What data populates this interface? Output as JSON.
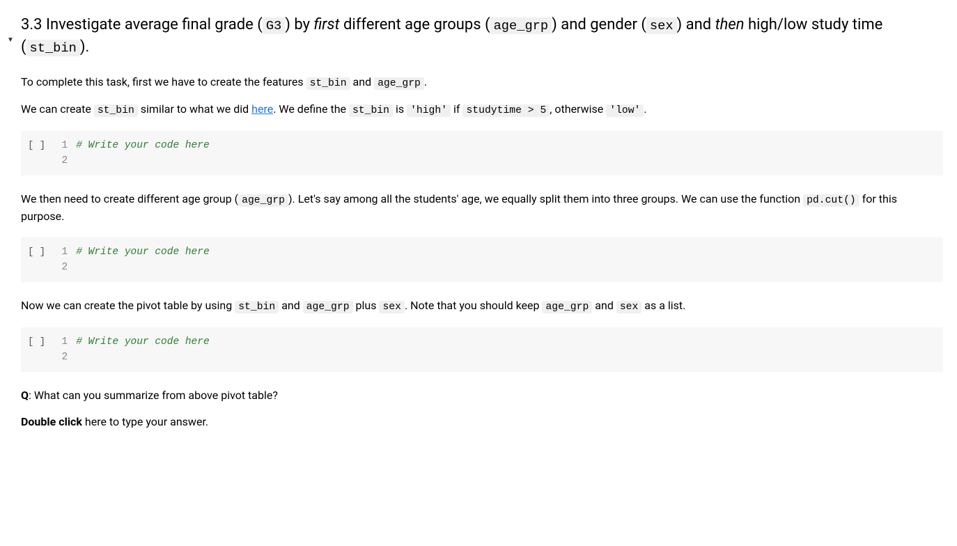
{
  "heading": {
    "prefix": "3.3 Investigate average final grade (",
    "g3": "G3",
    "after_g3": ") by ",
    "first": "first",
    "after_first": " different age groups (",
    "age_grp": "age_grp",
    "after_age_grp": ") and gender (",
    "sex": "sex",
    "after_sex": ") and ",
    "then": "then",
    "after_then": " high/low study time (",
    "st_bin": "st_bin",
    "suffix": ")."
  },
  "p1": {
    "t1": "To complete this task, first we have to create the features ",
    "c1": "st_bin",
    "t2": " and ",
    "c2": "age_grp",
    "t3": "."
  },
  "p2": {
    "t1": "We can create ",
    "c1": "st_bin",
    "t2": " similar to what we did ",
    "link": "here",
    "t3": ". We define the ",
    "c2": "st_bin",
    "t4": " is ",
    "c3": "'high'",
    "t5": " if ",
    "c4": "studytime > 5",
    "t6": ", otherwise ",
    "c5": "'low'",
    "t7": "."
  },
  "p3": {
    "t1": "We then need to create different age group (",
    "c1": "age_grp",
    "t2": "). Let's say among all the students' age, we equally split them into three groups. We can use the function ",
    "c2": "pd.cut()",
    "t3": " for this purpose."
  },
  "p4": {
    "t1": "Now we can create the pivot table by using ",
    "c1": "st_bin",
    "t2": " and ",
    "c2": "age_grp",
    "t3": " plus ",
    "c3": "sex",
    "t4": ". Note that you should keep ",
    "c4": "age_grp",
    "t5": " and ",
    "c5": "sex",
    "t6": " as a list."
  },
  "q": {
    "q": "Q",
    "t": ": What can you summarize from above pivot table?"
  },
  "dbl": {
    "b": "Double click",
    "t": " here to type your answer."
  },
  "exec_prompt": "[ ]",
  "code_cells": {
    "cell1": {
      "lines": [
        {
          "n": "1",
          "text": "# Write your code here",
          "comment": true
        },
        {
          "n": "2",
          "text": "",
          "comment": false
        }
      ]
    },
    "cell2": {
      "lines": [
        {
          "n": "1",
          "text": "# Write your code here",
          "comment": true
        },
        {
          "n": "2",
          "text": "",
          "comment": false
        }
      ]
    },
    "cell3": {
      "lines": [
        {
          "n": "1",
          "text": "# Write your code here",
          "comment": true
        },
        {
          "n": "2",
          "text": "",
          "comment": false
        }
      ]
    }
  }
}
